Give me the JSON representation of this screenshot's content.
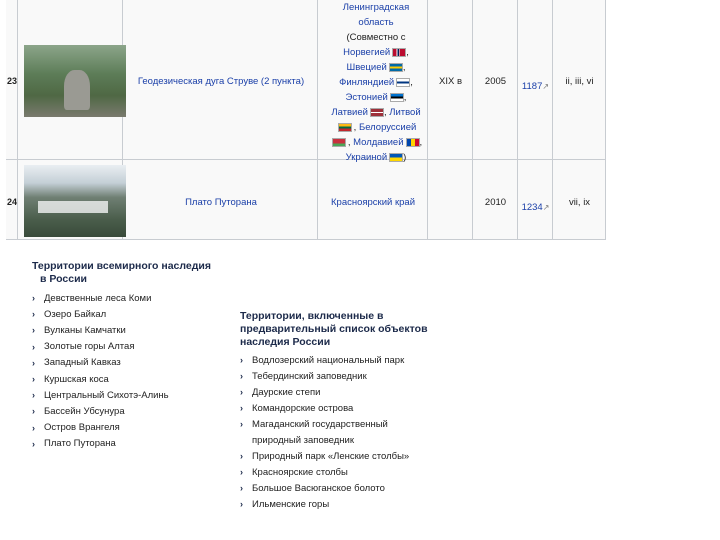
{
  "table": {
    "rows": [
      {
        "num": "23",
        "name": "Геодезическая дуга Струве (2 пункта)",
        "region_lines": [
          "Ленинградская",
          "область",
          "(Совместно с"
        ],
        "countries": [
          {
            "name": "Норвегией",
            "suffix": ","
          },
          {
            "name": "Швецией",
            "suffix": ","
          },
          {
            "name": "Финляндией",
            "suffix": ","
          },
          {
            "name": "Эстонией",
            "suffix": ","
          },
          {
            "name": "Латвией",
            "suffix": ", "
          },
          {
            "name": "Литвой",
            "suffix": ""
          },
          {
            "name": "Белоруссией",
            "suffix": ""
          },
          {
            "name": "Молдавией",
            "suffix": ","
          },
          {
            "name": "Украиной",
            "suffix": ")"
          }
        ],
        "century": "XIX в",
        "year": "2005",
        "id": "1187",
        "criteria": "ii, iii, vi"
      },
      {
        "num": "24",
        "name": "Плато Путорана",
        "region": "Красноярский край",
        "year": "2010",
        "id": "1234",
        "criteria": "vii, ix"
      }
    ],
    "ext_icon": "external-link-icon"
  },
  "panel_left": {
    "title_line1": "Территории всемирного наследия",
    "title_line2": "в России",
    "items": [
      "Девственные леса Коми",
      "Озеро Байкал",
      "Вулканы Камчатки",
      "Золотые горы Алтая",
      "Западный Кавказ",
      "Куршская коса",
      "Центральный Сихотэ-Алинь",
      "Бассейн Убсунура",
      "Остров Врангеля",
      "Плато Путорана"
    ]
  },
  "panel_right": {
    "title_line1": "Территории, включенные в",
    "title_line2": "предварительный список объектов",
    "title_line3": "наследия России",
    "items": [
      "Водлозерский национальный парк",
      "Тебердинский заповедник",
      "Даурские степи",
      "Командорские острова",
      "Магаданский государственный",
      "природный заповедник",
      "Природный парк «Ленские столбы»",
      "Красноярские столбы",
      "Большое Васюганское болото",
      "Ильменские горы"
    ]
  },
  "colors": {
    "link": "#1a3fa8",
    "border": "#c8ccd1",
    "table_bg": "#f9f9f9"
  }
}
